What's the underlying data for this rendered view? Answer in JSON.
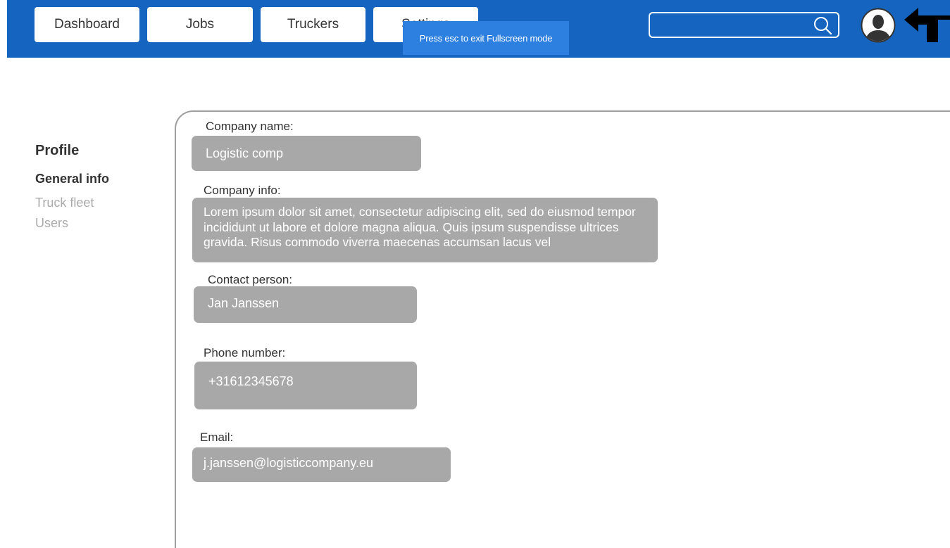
{
  "nav": {
    "dashboard_label": "Dashboard",
    "jobs_label": "Jobs",
    "truckers_label": "Truckers",
    "settings_label": "Settings"
  },
  "toast": {
    "text": "Press esc to exit Fullscreen mode"
  },
  "search": {
    "value": ""
  },
  "sidebar": {
    "title": "Profile",
    "items": [
      {
        "label": "General info",
        "active": true
      },
      {
        "label": "Truck fleet",
        "active": false
      },
      {
        "label": "Users",
        "active": false
      }
    ]
  },
  "form": {
    "company_name": {
      "label": "Company name:",
      "value": "Logistic comp"
    },
    "company_info": {
      "label": "Company info:",
      "value": "Lorem ipsum dolor sit amet, consectetur adipiscing elit, sed do eiusmod tempor incididunt ut labore et dolore magna aliqua. Quis ipsum suspendisse ultrices gravida. Risus commodo viverra maecenas accumsan lacus vel"
    },
    "contact_person": {
      "label": "Contact person:",
      "value": "Jan Janssen"
    },
    "phone_number": {
      "label": "Phone number:",
      "value": "+31612345678"
    },
    "email": {
      "label": "Email:",
      "value": "j.janssen@logisticcompany.eu"
    }
  },
  "colors": {
    "topbar": "#1565c0",
    "toast": "#2d7fe0",
    "field_bg": "#a8a8a8"
  },
  "icons": {
    "search": "search-icon",
    "avatar": "user-avatar-icon",
    "logout": "exit-arrow-icon"
  }
}
